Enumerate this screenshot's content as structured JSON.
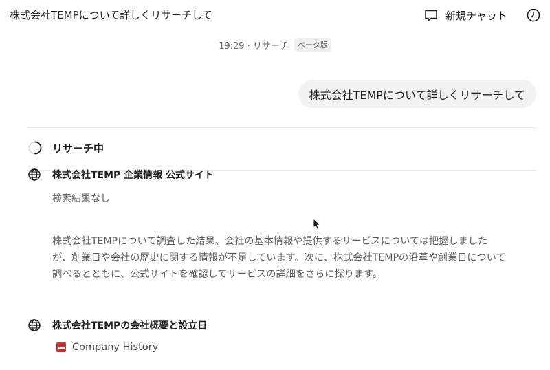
{
  "header": {
    "chat_title": "株式会社TEMPについて詳しくリサーチして",
    "new_chat_label": "新規チャット"
  },
  "meta": {
    "time_and_mode": "19:29 · リサーチ",
    "beta_badge": "ベータ版"
  },
  "user_message": "株式会社TEMPについて詳しくリサーチして",
  "research": {
    "status_label": "リサーチ中",
    "steps": [
      {
        "icon": "globe-icon",
        "title": "株式会社TEMP 企業情報 公式サイト",
        "result": "検索結果なし"
      },
      {
        "icon": "globe-icon",
        "title": "株式会社TEMPの会社概要と設立日",
        "source": "Company History"
      }
    ],
    "thinking_text": "株式会社TEMPについて調査した結果、会社の基本情報や提供するサービスについては把握しましたが、創業日や会社の歴史に関する情報が不足しています。次に、株式会社TEMPの沿革や創業日について調べるとともに、公式サイトを確認してサービスの詳細をさらに探ります。"
  },
  "colors": {
    "source_favicon": "#d0312d",
    "bubble_bg": "#f2f2f2"
  }
}
